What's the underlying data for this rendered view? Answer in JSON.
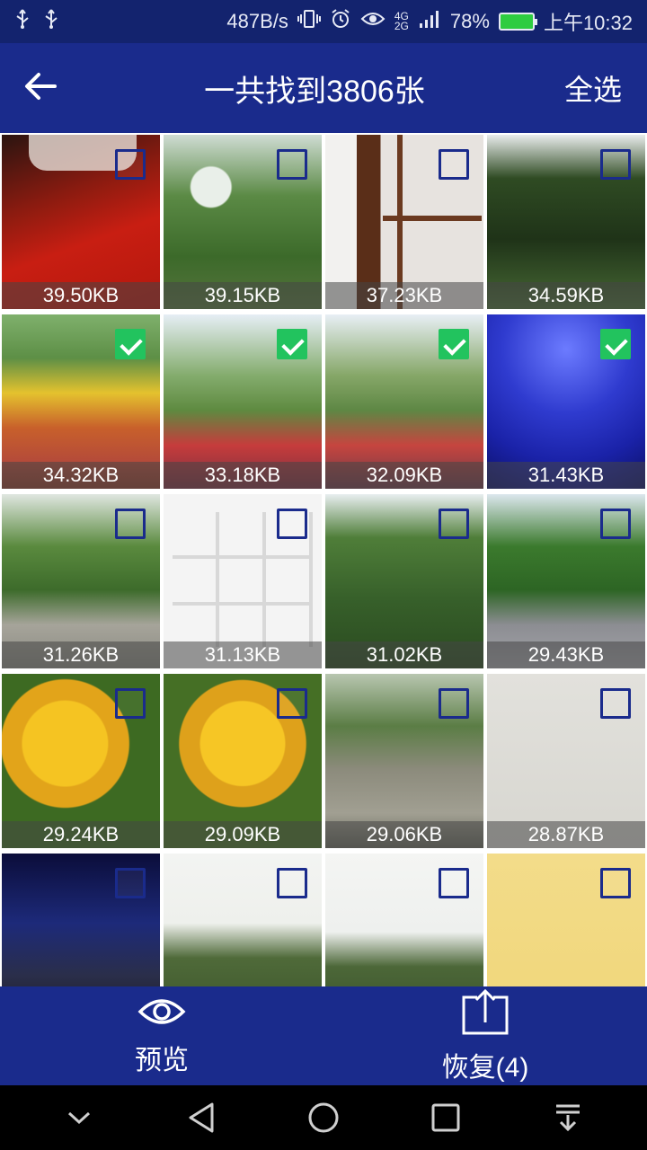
{
  "status_bar": {
    "net_speed": "487B/s",
    "network_top": "4G",
    "network_bottom": "2G",
    "signal_label": "2G",
    "battery": "78%",
    "time": "上午10:32"
  },
  "app_bar": {
    "title": "一共找到3806张",
    "select_all": "全选"
  },
  "photos": [
    {
      "size": "39.50KB",
      "checked": false,
      "thumb": "t-red"
    },
    {
      "size": "39.15KB",
      "checked": false,
      "thumb": "t-trees1"
    },
    {
      "size": "37.23KB",
      "checked": false,
      "thumb": "t-door"
    },
    {
      "size": "34.59KB",
      "checked": false,
      "thumb": "t-trees2"
    },
    {
      "size": "34.32KB",
      "checked": true,
      "thumb": "t-flowers"
    },
    {
      "size": "33.18KB",
      "checked": true,
      "thumb": "t-crowd1"
    },
    {
      "size": "32.09KB",
      "checked": true,
      "thumb": "t-crowd2"
    },
    {
      "size": "31.43KB",
      "checked": true,
      "thumb": "t-blue"
    },
    {
      "size": "31.26KB",
      "checked": false,
      "thumb": "t-path1"
    },
    {
      "size": "31.13KB",
      "checked": false,
      "thumb": "t-meme"
    },
    {
      "size": "31.02KB",
      "checked": false,
      "thumb": "t-forest"
    },
    {
      "size": "29.43KB",
      "checked": false,
      "thumb": "t-road"
    },
    {
      "size": "29.24KB",
      "checked": false,
      "thumb": "t-yellow"
    },
    {
      "size": "29.09KB",
      "checked": false,
      "thumb": "t-yellow2"
    },
    {
      "size": "29.06KB",
      "checked": false,
      "thumb": "t-stairs"
    },
    {
      "size": "28.87KB",
      "checked": false,
      "thumb": "t-wall"
    },
    {
      "size": "",
      "checked": false,
      "thumb": "t-party"
    },
    {
      "size": "",
      "checked": false,
      "thumb": "t-sky1"
    },
    {
      "size": "",
      "checked": false,
      "thumb": "t-sky2"
    },
    {
      "size": "",
      "checked": false,
      "thumb": "t-note"
    }
  ],
  "actions": {
    "preview_label": "预览",
    "restore_label": "恢复(4)"
  },
  "icons": {
    "back": "arrow-left-icon",
    "preview": "eye-icon",
    "restore": "upload-icon",
    "nav": [
      "chevron-down-icon",
      "back-triangle-icon",
      "home-circle-icon",
      "recents-square-icon",
      "notification-pull-icon"
    ]
  },
  "colors": {
    "primary": "#1a2b8c",
    "status_bar": "#13236e",
    "checked": "#22c35e"
  }
}
